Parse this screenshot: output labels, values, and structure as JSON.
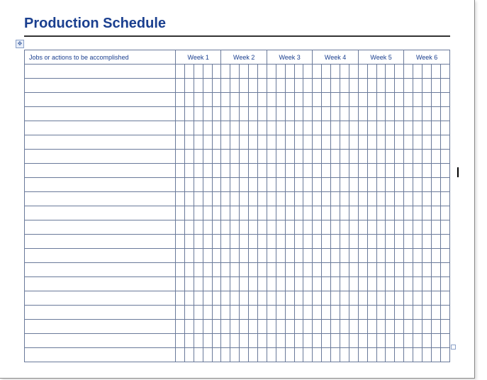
{
  "title": "Production Schedule",
  "header": {
    "jobs_column": "Jobs or actions to be accomplished",
    "weeks": [
      "Week 1",
      "Week 2",
      "Week 3",
      "Week 4",
      "Week 5",
      "Week 6"
    ]
  },
  "layout": {
    "sub_columns_per_week": 5,
    "body_rows": 21
  }
}
